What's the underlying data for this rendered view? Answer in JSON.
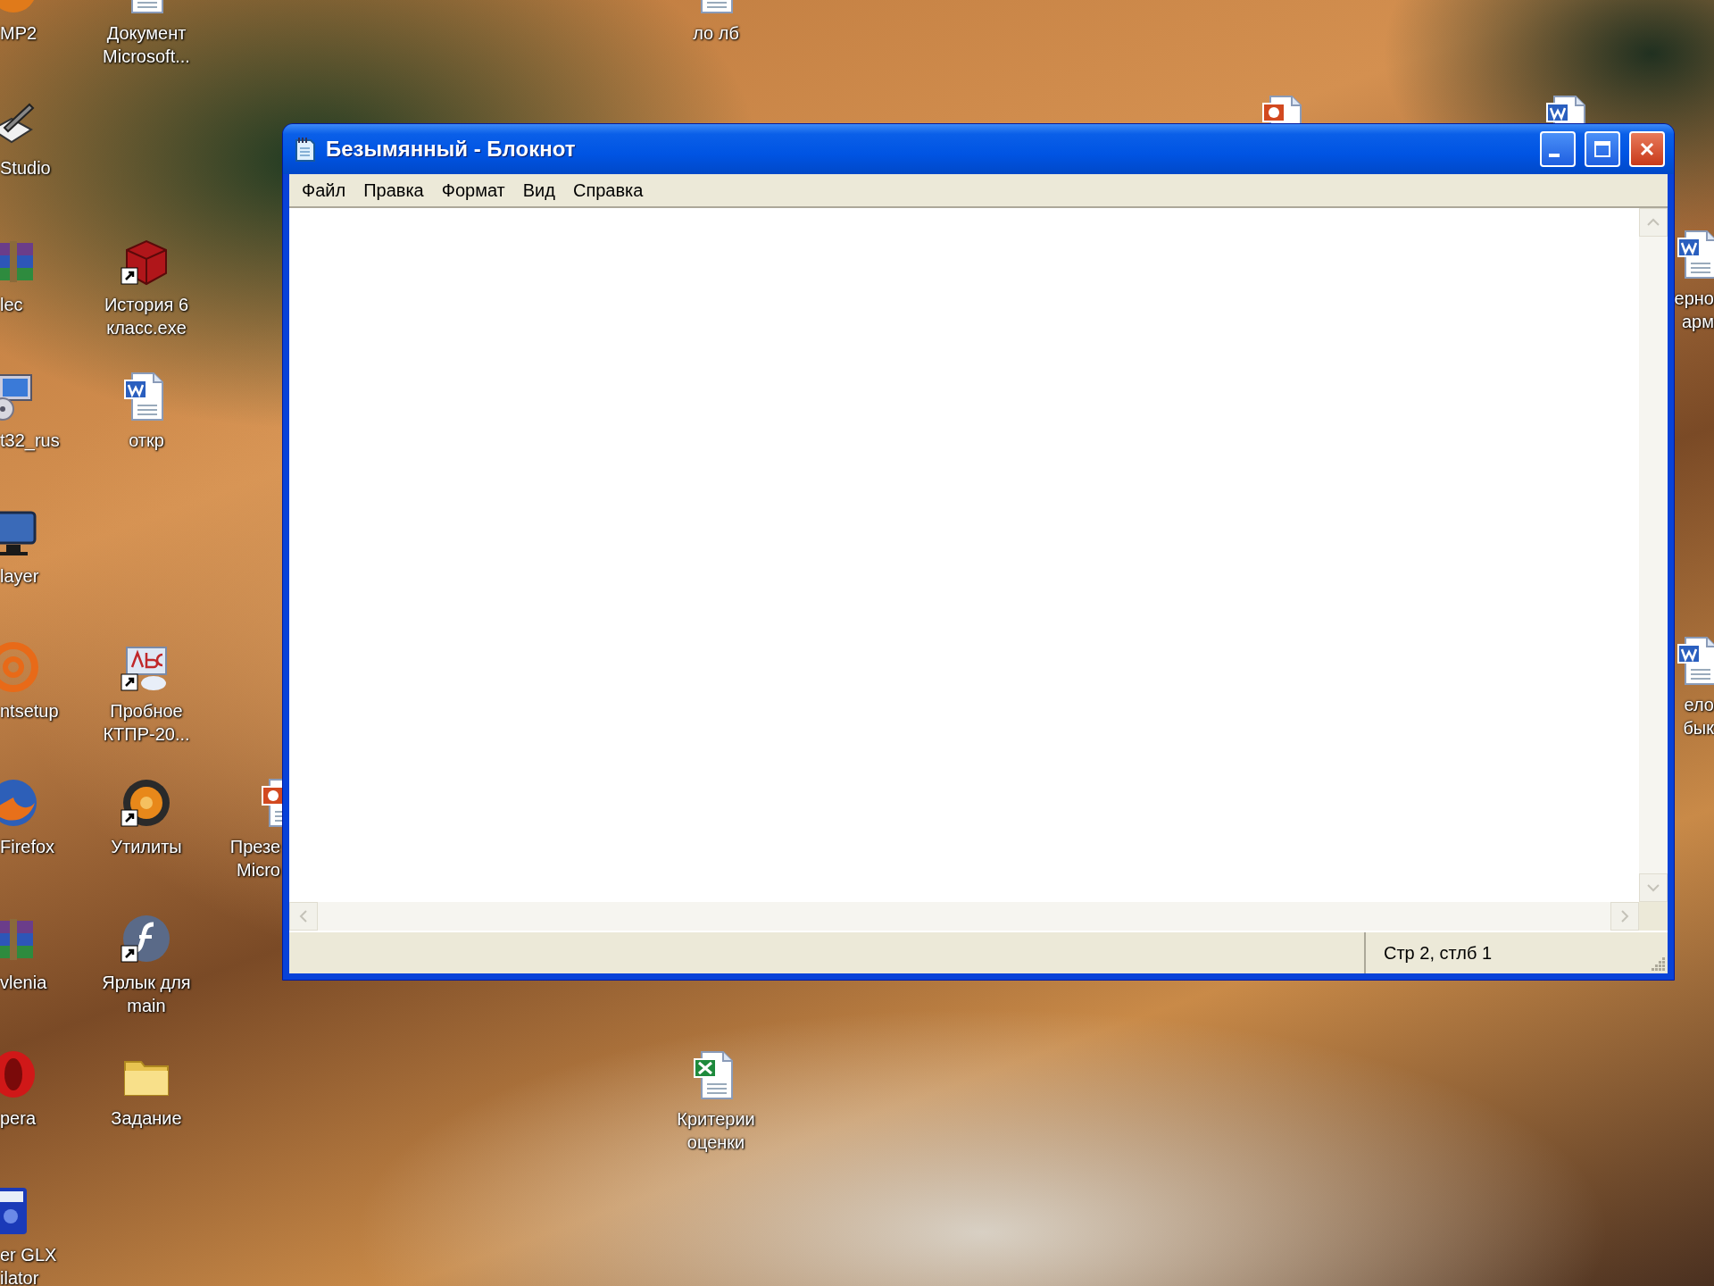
{
  "desktop": {
    "icons": [
      {
        "kind": "media",
        "lines": [
          "MP2"
        ],
        "shortcut": false
      },
      {
        "kind": "pen",
        "lines": [
          "Studio"
        ],
        "shortcut": false
      },
      {
        "kind": "archive",
        "lines": [
          "lec"
        ],
        "shortcut": false
      },
      {
        "kind": "computer",
        "lines": [
          "t32_rus"
        ],
        "shortcut": false
      },
      {
        "kind": "monitor",
        "lines": [
          "layer"
        ],
        "shortcut": false
      },
      {
        "kind": "at",
        "lines": [
          "ntsetup"
        ],
        "shortcut": false
      },
      {
        "kind": "globe",
        "lines": [
          "Firefox"
        ],
        "shortcut": false
      },
      {
        "kind": "archive",
        "lines": [
          "vlenia"
        ],
        "shortcut": false
      },
      {
        "kind": "opera",
        "lines": [
          "pera"
        ],
        "shortcut": false
      },
      {
        "kind": "calc",
        "lines": [
          "er GLX",
          "ilator"
        ],
        "shortcut": false
      },
      {
        "kind": "page",
        "lines": [
          "Документ",
          "Microsoft..."
        ],
        "shortcut": false
      },
      {
        "kind": "cube",
        "lines": [
          "История 6",
          "класс.exe"
        ],
        "shortcut": true
      },
      {
        "kind": "word",
        "lines": [
          "откр"
        ],
        "shortcut": false
      },
      {
        "kind": "abc",
        "lines": [
          "Пробное",
          "КТПР-20..."
        ],
        "shortcut": true
      },
      {
        "kind": "ring",
        "lines": [
          "Утилиты"
        ],
        "shortcut": true
      },
      {
        "kind": "flash",
        "lines": [
          "Ярлык для",
          "main"
        ],
        "shortcut": true
      },
      {
        "kind": "folder",
        "lines": [
          "Задание"
        ],
        "shortcut": false
      },
      {
        "kind": "ppt",
        "lines": [
          "Презе",
          "Micro"
        ],
        "shortcut": false
      },
      {
        "kind": "page",
        "lines": [
          "ло лб"
        ],
        "shortcut": false
      },
      {
        "kind": "excel",
        "lines": [
          "Критерии",
          "оценки"
        ],
        "shortcut": false
      },
      {
        "kind": "ppt"
      },
      {
        "kind": "word"
      },
      {
        "kind": "word",
        "lines": [
          "ерно",
          "арм"
        ],
        "shortcut": false
      },
      {
        "kind": "word",
        "lines": [
          "ело",
          "бык"
        ],
        "shortcut": false
      }
    ]
  },
  "window": {
    "title": "Безымянный - Блокнот",
    "menu": [
      "Файл",
      "Правка",
      "Формат",
      "Вид",
      "Справка"
    ],
    "status_bar": {
      "position": "Стр 2, стлб 1"
    }
  }
}
